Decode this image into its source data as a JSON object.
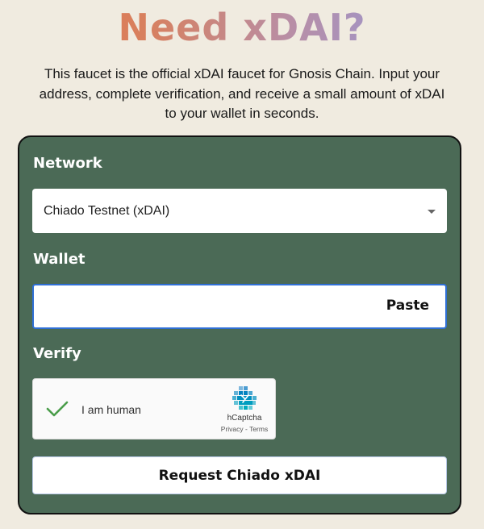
{
  "header": {
    "title": "Need xDAI?",
    "subtitle": "This faucet is the official xDAI faucet for Gnosis Chain. Input your address, complete verification, and receive a small amount of xDAI to your wallet in seconds."
  },
  "form": {
    "network_label": "Network",
    "network_selected": "Chiado Testnet (xDAI)",
    "wallet_label": "Wallet",
    "wallet_value": "",
    "paste_label": "Paste",
    "verify_label": "Verify",
    "captcha": {
      "checkbox_label": "I am human",
      "brand": "hCaptcha",
      "links": "Privacy - Terms"
    },
    "submit_label": "Request Chiado xDAI"
  },
  "colors": {
    "background": "#f0ebe0",
    "card": "#4b6a56",
    "input_focus": "#2f6fd6",
    "check": "#4a9d4a"
  },
  "icons": [
    "chevron-down-icon",
    "checkmark-icon",
    "hcaptcha-logo-icon"
  ]
}
